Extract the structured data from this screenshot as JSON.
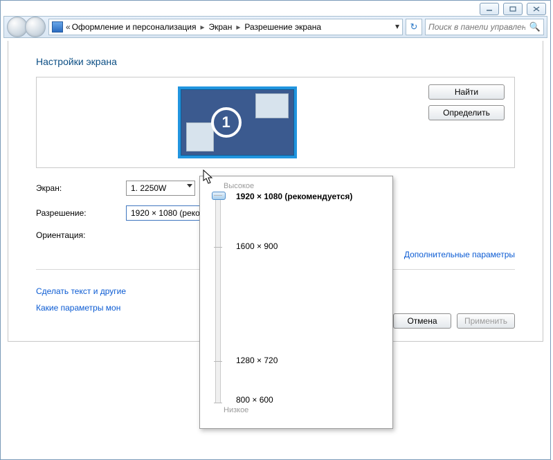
{
  "breadcrumb": {
    "parent": "Оформление и персонализация",
    "mid": "Экран",
    "leaf": "Разрешение экрана"
  },
  "search": {
    "placeholder": "Поиск в панели управления"
  },
  "page": {
    "title": "Настройки экрана"
  },
  "preview": {
    "monitor_number": "1",
    "find_btn": "Найти",
    "identify_btn": "Определить"
  },
  "form": {
    "display_label": "Экран:",
    "display_value": "1. 2250W",
    "resolution_label": "Разрешение:",
    "resolution_value": "1920 × 1080 (рекомендуется)",
    "orientation_label": "Ориентация:"
  },
  "links": {
    "advanced": "Дополнительные параметры",
    "text_size": "Сделать текст и другие",
    "help": "Какие параметры мон"
  },
  "buttons": {
    "ok_hidden": "",
    "cancel": "Отмена",
    "apply": "Применить"
  },
  "popup": {
    "high": "Высокое",
    "low": "Низкое",
    "options": [
      "1920 × 1080 (рекомендуется)",
      "1600 × 900",
      "1280 × 720",
      "800 × 600"
    ]
  }
}
